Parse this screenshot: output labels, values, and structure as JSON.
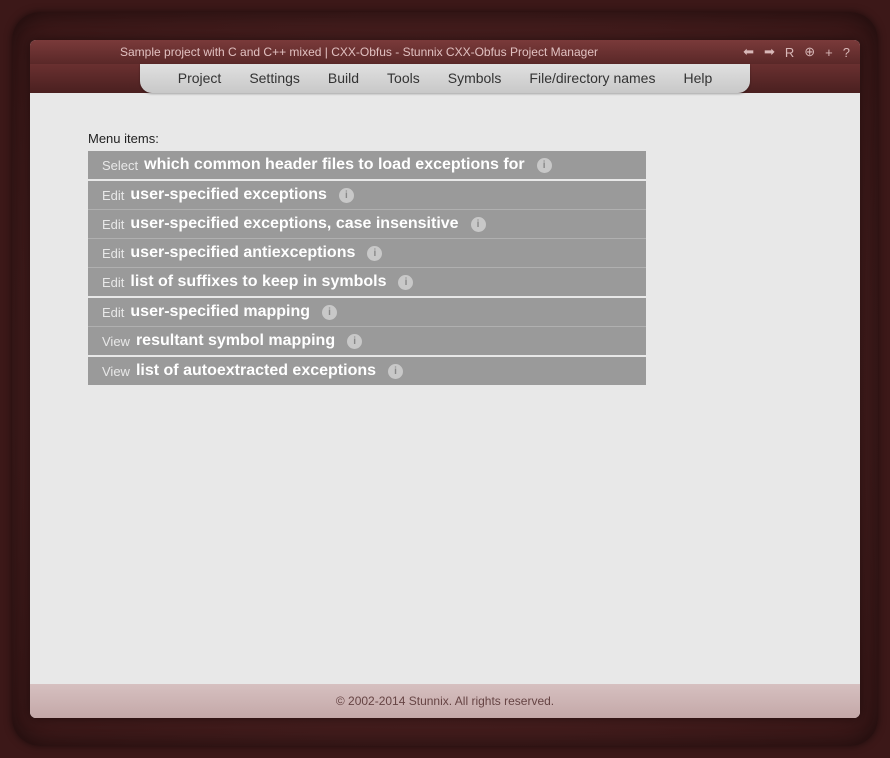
{
  "title": "Sample project with C and C++ mixed | CXX-Obfus - Stunnix CXX-Obfus Project Manager",
  "toolbar_icons": {
    "back": "⬅",
    "forward": "➡",
    "reload": "R",
    "zoom": "⊕",
    "plus": "+",
    "help": "?"
  },
  "menubar": [
    "Project",
    "Settings",
    "Build",
    "Tools",
    "Symbols",
    "File/directory names",
    "Help"
  ],
  "content_label": "Menu items:",
  "groups": [
    [
      {
        "verb": "Select",
        "text": "which common header files to load exceptions for"
      }
    ],
    [
      {
        "verb": "Edit",
        "text": "user-specified exceptions"
      },
      {
        "verb": "Edit",
        "text": "user-specified exceptions, case insensitive"
      },
      {
        "verb": "Edit",
        "text": "user-specified antiexceptions"
      },
      {
        "verb": "Edit",
        "text": "list of suffixes to keep in symbols"
      }
    ],
    [
      {
        "verb": "Edit",
        "text": "user-specified mapping"
      },
      {
        "verb": "View",
        "text": "resultant symbol mapping"
      }
    ],
    [
      {
        "verb": "View",
        "text": "list of autoextracted exceptions"
      }
    ]
  ],
  "footer": "© 2002-2014 Stunnix. All rights reserved."
}
